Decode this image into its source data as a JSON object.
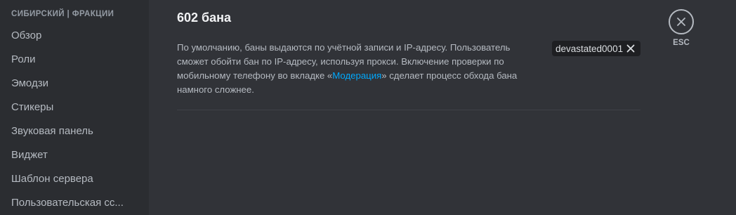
{
  "sidebar": {
    "header": "СИБИРСКИЙ | ФРАКЦИИ",
    "items": [
      {
        "label": "Обзор"
      },
      {
        "label": "Роли"
      },
      {
        "label": "Эмодзи"
      },
      {
        "label": "Стикеры"
      },
      {
        "label": "Звуковая панель"
      },
      {
        "label": "Виджет"
      },
      {
        "label": "Шаблон сервера"
      },
      {
        "label": "Пользовательская сс..."
      }
    ]
  },
  "main": {
    "title": "602 бана",
    "description": {
      "before_link": "По умолчанию, баны выдаются по учётной записи и IP-адресу. Пользователь сможет обойти бан по IP-адресу, используя прокси. Включение проверки по мобильному телефону во вкладке «",
      "link": "Модерация",
      "after_link": "» сделает процесс обхода бана намного сложнее."
    },
    "search": {
      "value": "devastated0001",
      "clear_icon": "close-icon"
    }
  },
  "close": {
    "label": "ESC",
    "icon": "close-icon"
  },
  "colors": {
    "sidebar_bg": "#2b2d31",
    "main_bg": "#313338",
    "link": "#00a8fc"
  }
}
